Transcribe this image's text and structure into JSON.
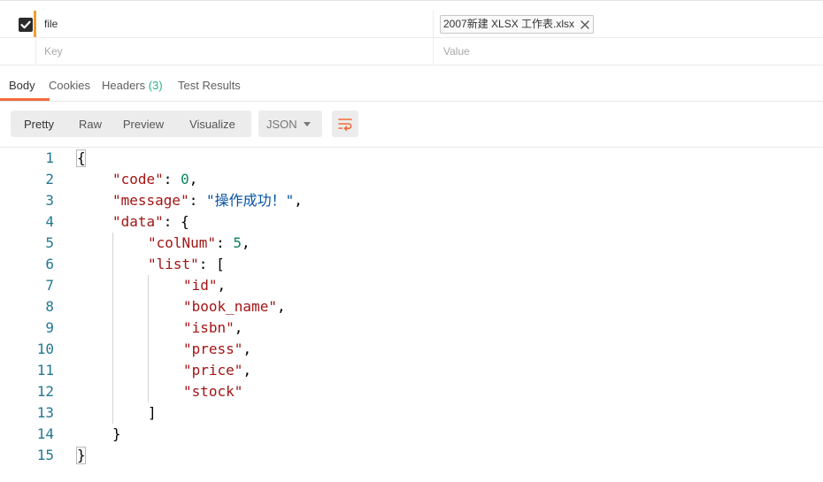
{
  "params": {
    "rows": [
      {
        "checked": true,
        "key": "file",
        "value_file": "2007新建 XLSX 工作表.xlsx"
      },
      {
        "key_placeholder": "Key",
        "value_placeholder": "Value"
      }
    ]
  },
  "response_tabs": {
    "body": "Body",
    "cookies": "Cookies",
    "headers": "Headers",
    "headers_count": "(3)",
    "test_results": "Test Results"
  },
  "toolbar": {
    "pretty": "Pretty",
    "raw": "Raw",
    "preview": "Preview",
    "visualize": "Visualize",
    "format": "JSON",
    "wrap_icon": "wrap-lines-icon"
  },
  "code": {
    "lines": [
      {
        "n": "1",
        "indent": 0,
        "tokens": [
          [
            "pun",
            "{"
          ]
        ]
      },
      {
        "n": "2",
        "indent": 1,
        "tokens": [
          [
            "key",
            "\"code\""
          ],
          [
            "pun",
            ": "
          ],
          [
            "num",
            "0"
          ],
          [
            "pun",
            ","
          ]
        ]
      },
      {
        "n": "3",
        "indent": 1,
        "tokens": [
          [
            "key",
            "\"message\""
          ],
          [
            "pun",
            ": "
          ],
          [
            "str",
            "\"操作成功！\""
          ],
          [
            "pun",
            ","
          ]
        ]
      },
      {
        "n": "4",
        "indent": 1,
        "tokens": [
          [
            "key",
            "\"data\""
          ],
          [
            "pun",
            ": {"
          ]
        ]
      },
      {
        "n": "5",
        "indent": 2,
        "tokens": [
          [
            "key",
            "\"colNum\""
          ],
          [
            "pun",
            ": "
          ],
          [
            "num",
            "5"
          ],
          [
            "pun",
            ","
          ]
        ]
      },
      {
        "n": "6",
        "indent": 2,
        "tokens": [
          [
            "key",
            "\"list\""
          ],
          [
            "pun",
            ": ["
          ]
        ]
      },
      {
        "n": "7",
        "indent": 3,
        "tokens": [
          [
            "key",
            "\"id\""
          ],
          [
            "pun",
            ","
          ]
        ]
      },
      {
        "n": "8",
        "indent": 3,
        "tokens": [
          [
            "key",
            "\"book_name\""
          ],
          [
            "pun",
            ","
          ]
        ]
      },
      {
        "n": "9",
        "indent": 3,
        "tokens": [
          [
            "key",
            "\"isbn\""
          ],
          [
            "pun",
            ","
          ]
        ]
      },
      {
        "n": "10",
        "indent": 3,
        "tokens": [
          [
            "key",
            "\"press\""
          ],
          [
            "pun",
            ","
          ]
        ]
      },
      {
        "n": "11",
        "indent": 3,
        "tokens": [
          [
            "key",
            "\"price\""
          ],
          [
            "pun",
            ","
          ]
        ]
      },
      {
        "n": "12",
        "indent": 3,
        "tokens": [
          [
            "key",
            "\"stock\""
          ]
        ]
      },
      {
        "n": "13",
        "indent": 2,
        "tokens": [
          [
            "pun",
            "]"
          ]
        ]
      },
      {
        "n": "14",
        "indent": 1,
        "tokens": [
          [
            "pun",
            "}"
          ]
        ]
      },
      {
        "n": "15",
        "indent": 0,
        "tokens": [
          [
            "pun",
            "}"
          ]
        ]
      }
    ]
  },
  "colors": {
    "accent": "#f26b3a",
    "key": "#a31515",
    "string": "#0451a5",
    "number": "#098658",
    "line_number": "#237893",
    "headers_count": "#26b47f"
  }
}
